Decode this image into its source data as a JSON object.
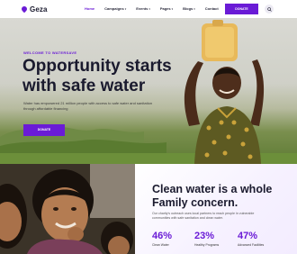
{
  "header": {
    "logo_text": "Geza",
    "nav": [
      {
        "label": "Home",
        "active": true,
        "caret": false
      },
      {
        "label": "Campaigns",
        "active": false,
        "caret": true
      },
      {
        "label": "Events",
        "active": false,
        "caret": true
      },
      {
        "label": "Pages",
        "active": false,
        "caret": true
      },
      {
        "label": "Blogs",
        "active": false,
        "caret": true
      },
      {
        "label": "Contact",
        "active": false,
        "caret": false
      }
    ],
    "donate_label": "DONATE",
    "search_icon": "search-icon"
  },
  "hero": {
    "eyebrow": "WELCOME TO WATERSAVE",
    "title": "Opportunity starts with safe water",
    "description": "Water has empowered 21 million people with access to safe water and sanitation through affordable financing",
    "button_label": "DONATE"
  },
  "info": {
    "title": "Clean water is a whole Family concern.",
    "description": "Our charity's outreach uses local partners to reach people in vulnerable communities with safe sanitation and clean water.",
    "stats": [
      {
        "value": "46%",
        "label": "Clean Water"
      },
      {
        "value": "23%",
        "label": "Healthy Programs"
      },
      {
        "value": "47%",
        "label": "Advanced Facilities"
      }
    ]
  },
  "colors": {
    "accent": "#6a1bd6",
    "heading": "#1a1a2e"
  }
}
